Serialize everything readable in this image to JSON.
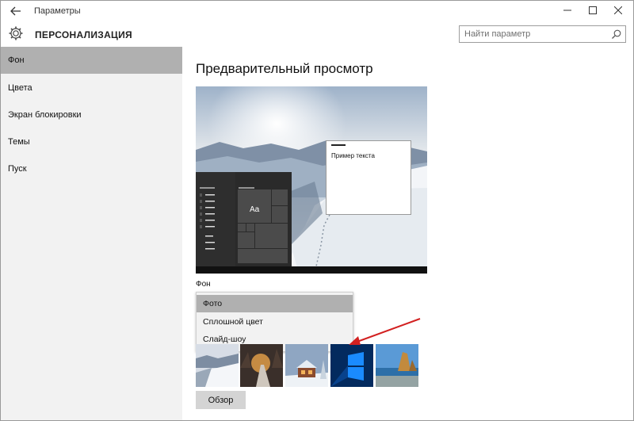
{
  "window": {
    "title": "Параметры",
    "back_icon": "arrow-left-icon",
    "controls": {
      "minimize": "—",
      "maximize": "☐",
      "close": "✕"
    }
  },
  "header": {
    "section_title": "ПЕРСОНАЛИЗАЦИЯ",
    "gear_icon": "gear-icon",
    "search_placeholder": "Найти параметр",
    "search_icon": "search-icon"
  },
  "sidebar": {
    "items": [
      {
        "label": "Фон",
        "active": true
      },
      {
        "label": "Цвета",
        "active": false
      },
      {
        "label": "Экран блокировки",
        "active": false
      },
      {
        "label": "Темы",
        "active": false
      },
      {
        "label": "Пуск",
        "active": false
      }
    ]
  },
  "main": {
    "preview_title": "Предварительный просмотр",
    "preview": {
      "sample_text": "Пример текста",
      "tile_label": "Aa"
    },
    "background_label": "Фон",
    "dropdown": {
      "options": [
        {
          "label": "Фото",
          "selected": true
        },
        {
          "label": "Сплошной цвет",
          "selected": false
        },
        {
          "label": "Слайд-шоу",
          "selected": false
        }
      ]
    },
    "thumbnails": [
      "snow-mountain",
      "night-road",
      "winter-cabin",
      "windows-blue",
      "beach-rocks"
    ],
    "browse_button": "Обзор"
  },
  "colors": {
    "active_item_bg": "#b0b0b0",
    "sidebar_bg": "#f2f2f2",
    "annotation_arrow": "#d22020"
  }
}
